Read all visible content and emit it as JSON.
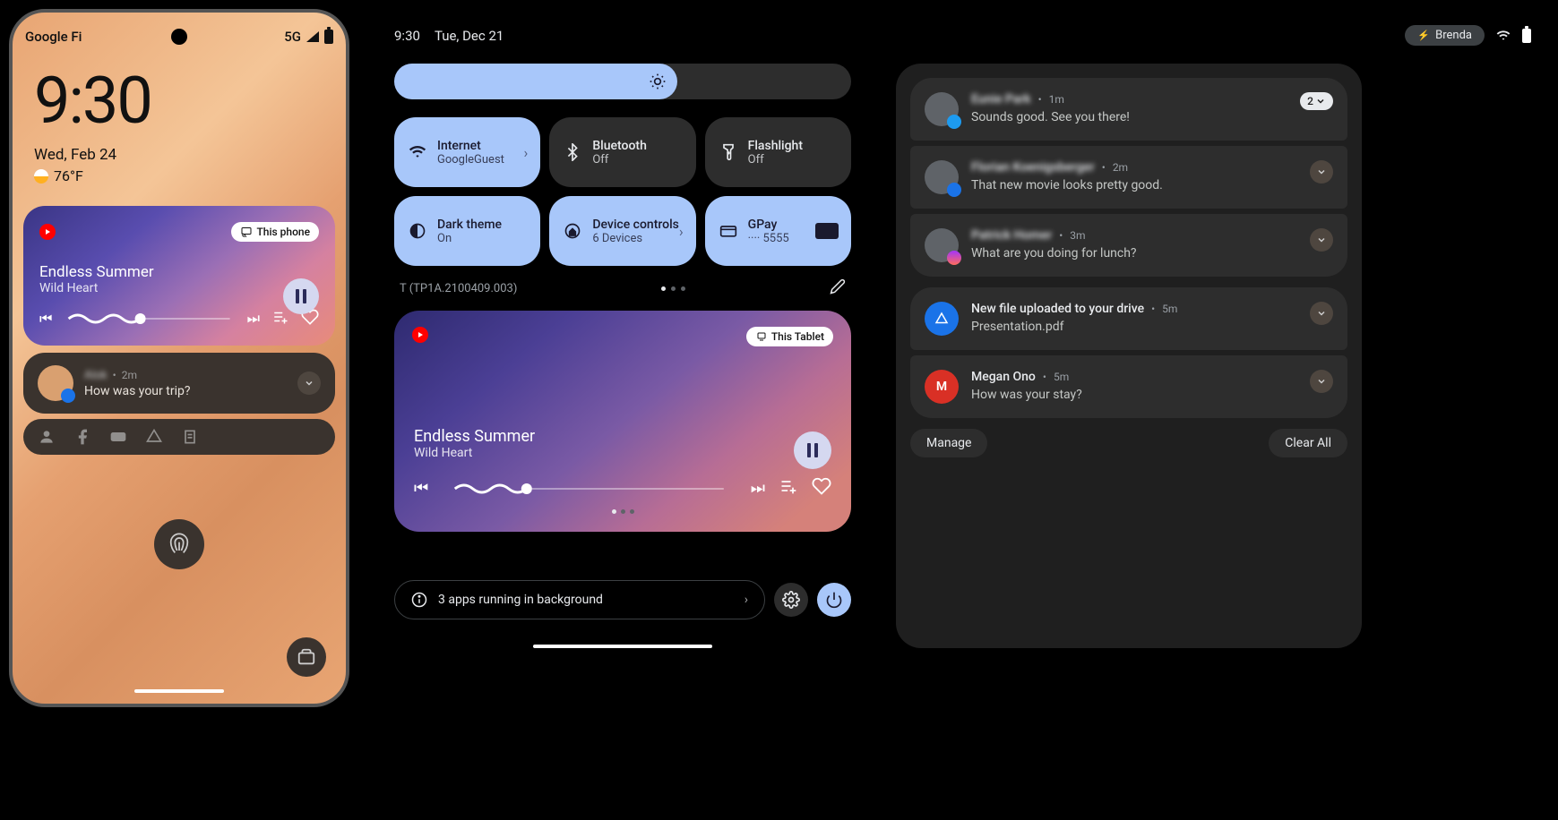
{
  "phone": {
    "carrier": "Google Fi",
    "network": "5G",
    "clock": "9:30",
    "date": "Wed, Feb 24",
    "temp": "76°F",
    "media": {
      "cast_label": "This phone",
      "track": "Endless Summer",
      "artist": "Wild Heart"
    },
    "notif": {
      "sender": "Alok",
      "time": "2m",
      "message": "How was your trip?"
    }
  },
  "tablet": {
    "clock": "9:30",
    "date": "Tue, Dec 21",
    "user": "Brenda",
    "tiles": [
      {
        "label": "Internet",
        "sub": "GoogleGuest",
        "active": true,
        "chevron": true,
        "icon": "wifi"
      },
      {
        "label": "Bluetooth",
        "sub": "Off",
        "active": false,
        "chevron": false,
        "icon": "bluetooth"
      },
      {
        "label": "Flashlight",
        "sub": "Off",
        "active": false,
        "chevron": false,
        "icon": "flashlight"
      },
      {
        "label": "Dark theme",
        "sub": "On",
        "active": true,
        "chevron": false,
        "icon": "darktheme"
      },
      {
        "label": "Device controls",
        "sub": "6 Devices",
        "active": true,
        "chevron": true,
        "icon": "home"
      },
      {
        "label": "GPay",
        "sub": "···· 5555",
        "active": true,
        "chevron": false,
        "icon": "card",
        "gpay": true
      }
    ],
    "build": "T (TP1A.2100409.003)",
    "media": {
      "cast_label": "This Tablet",
      "track": "Endless Summer",
      "artist": "Wild Heart"
    },
    "bg_apps": "3 apps running in background"
  },
  "notifs": [
    {
      "sender": "Eunie Park",
      "time": "1m",
      "msg": "Sounds good. See you there!",
      "count": "2",
      "badge": "tw",
      "blur": true
    },
    {
      "sender": "Florian Koenigsberger",
      "time": "2m",
      "msg": "That new movie looks pretty good.",
      "badge": "msg",
      "blur": true
    },
    {
      "sender": "Patrick Homer",
      "time": "3m",
      "msg": "What are you doing for lunch?",
      "badge": "mn",
      "blur": true
    },
    {
      "sender": "New file uploaded to your drive",
      "time": "5m",
      "msg": "Presentation.pdf",
      "icon": "drive"
    },
    {
      "sender": "Megan Ono",
      "time": "5m",
      "msg": "How was your stay?",
      "icon": "gmail"
    }
  ],
  "actions": {
    "manage": "Manage",
    "clear": "Clear All"
  }
}
